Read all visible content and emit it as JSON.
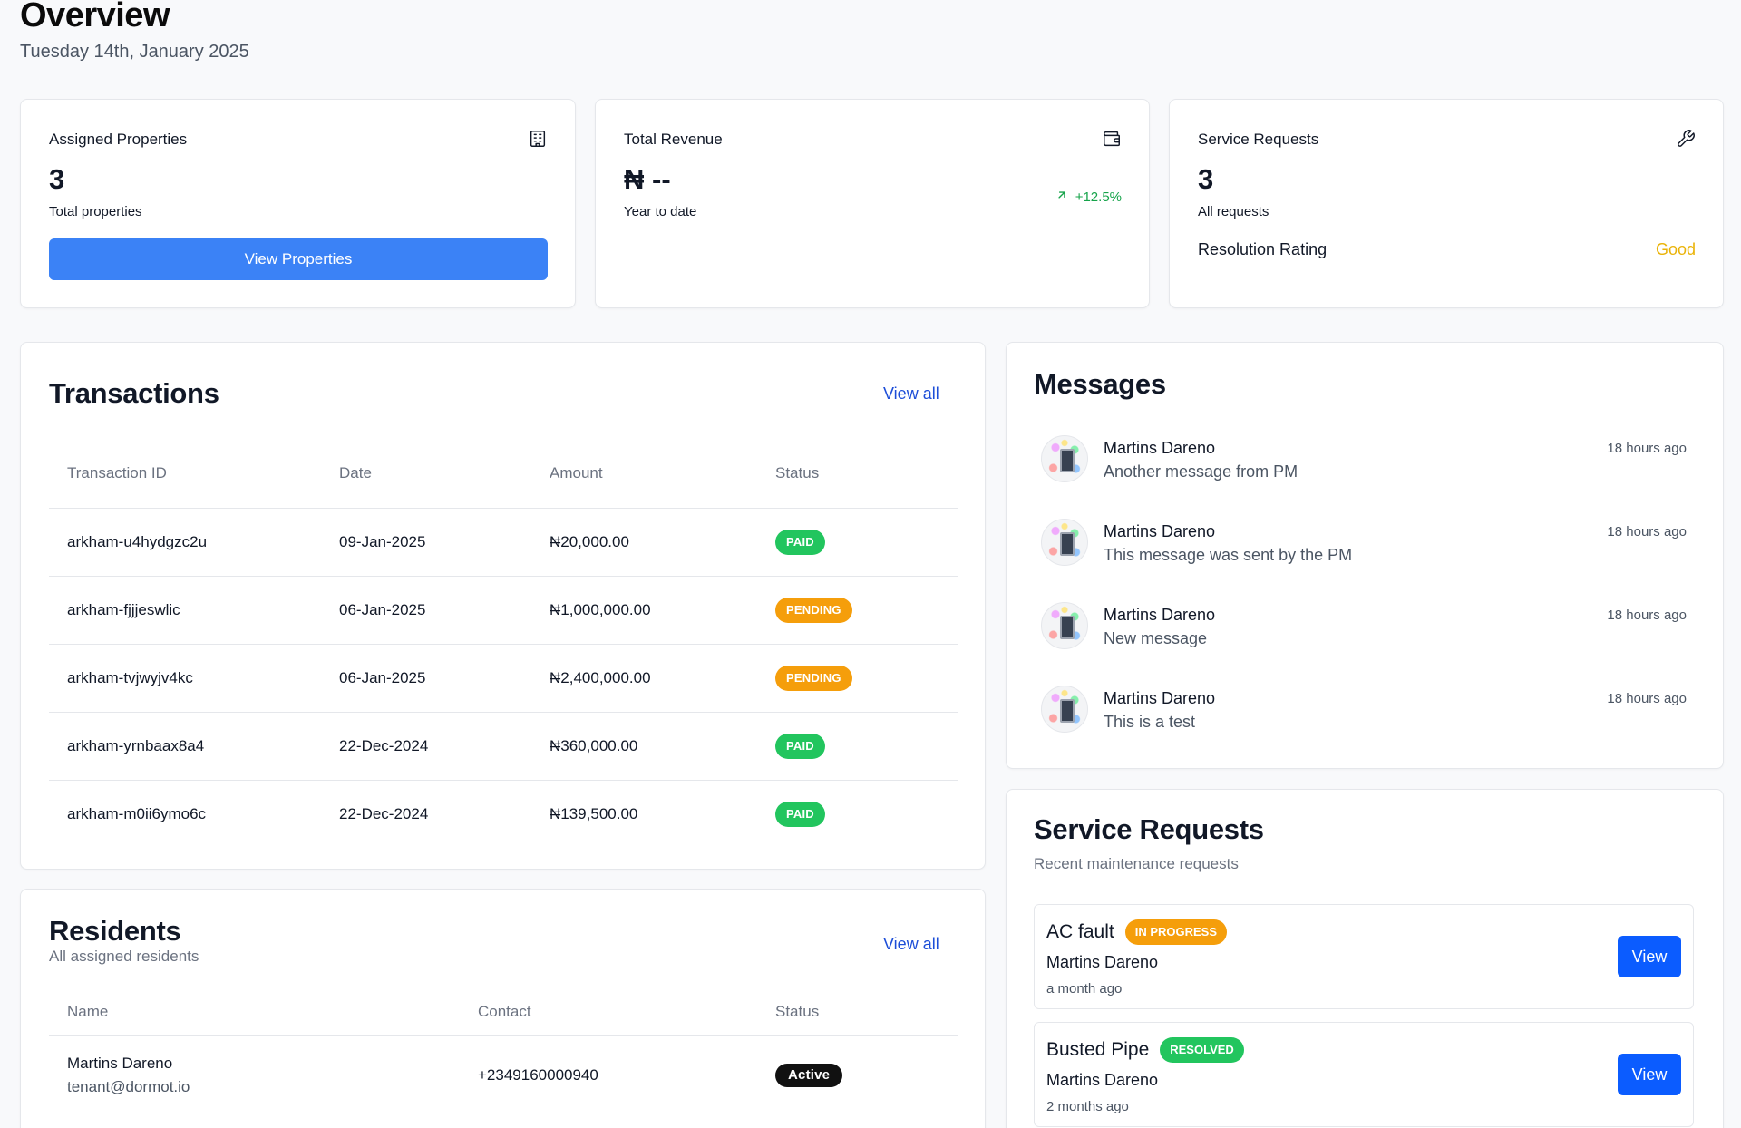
{
  "header": {
    "title": "Overview",
    "date": "Tuesday 14th, January 2025"
  },
  "stats": {
    "assigned": {
      "title": "Assigned Properties",
      "icon": "building-icon",
      "value": "3",
      "sub": "Total properties",
      "button": "View Properties"
    },
    "revenue": {
      "title": "Total Revenue",
      "icon": "wallet-icon",
      "value": "₦ --",
      "sub": "Year to date",
      "trend": "+12.5%",
      "trend_icon": "arrow-up-right-icon"
    },
    "service": {
      "title": "Service Requests",
      "icon": "wrench-icon",
      "value": "3",
      "sub": "All requests",
      "rating_label": "Resolution Rating",
      "rating_value": "Good"
    }
  },
  "transactions": {
    "title": "Transactions",
    "view_all": "View all",
    "columns": [
      "Transaction ID",
      "Date",
      "Amount",
      "Status"
    ],
    "rows": [
      {
        "id": "arkham-u4hydgzc2u",
        "date": "09-Jan-2025",
        "amount": "₦20,000.00",
        "status": "PAID"
      },
      {
        "id": "arkham-fjjjeswlic",
        "date": "06-Jan-2025",
        "amount": "₦1,000,000.00",
        "status": "PENDING"
      },
      {
        "id": "arkham-tvjwyjv4kc",
        "date": "06-Jan-2025",
        "amount": "₦2,400,000.00",
        "status": "PENDING"
      },
      {
        "id": "arkham-yrnbaax8a4",
        "date": "22-Dec-2024",
        "amount": "₦360,000.00",
        "status": "PAID"
      },
      {
        "id": "arkham-m0ii6ymo6c",
        "date": "22-Dec-2024",
        "amount": "₦139,500.00",
        "status": "PAID"
      }
    ]
  },
  "residents": {
    "title": "Residents",
    "subtitle": "All assigned residents",
    "view_all": "View all",
    "columns": [
      "Name",
      "Contact",
      "Status"
    ],
    "rows": [
      {
        "name": "Martins Dareno",
        "email": "tenant@dormot.io",
        "contact": "+2349160000940",
        "status": "Active"
      }
    ]
  },
  "messages": {
    "title": "Messages",
    "items": [
      {
        "name": "Martins Dareno",
        "text": "Another message from PM",
        "time": "18 hours ago"
      },
      {
        "name": "Martins Dareno",
        "text": "This message was sent by the PM",
        "time": "18 hours ago"
      },
      {
        "name": "Martins Dareno",
        "text": "New message",
        "time": "18 hours ago"
      },
      {
        "name": "Martins Dareno",
        "text": "This is a test",
        "time": "18 hours ago"
      }
    ]
  },
  "service_requests": {
    "title": "Service Requests",
    "subtitle": "Recent maintenance requests",
    "items": [
      {
        "title": "AC fault",
        "status": "IN PROGRESS",
        "name": "Martins Dareno",
        "time": "a month ago",
        "button": "View"
      },
      {
        "title": "Busted Pipe",
        "status": "RESOLVED",
        "name": "Martins Dareno",
        "time": "2 months ago",
        "button": "View"
      }
    ]
  },
  "colors": {
    "primary": "#3b82f6",
    "view_button": "#0b5cff",
    "paid": "#22c55e",
    "pending": "#f59e0b",
    "rating": "#eab308",
    "link": "#1d4ed8"
  }
}
